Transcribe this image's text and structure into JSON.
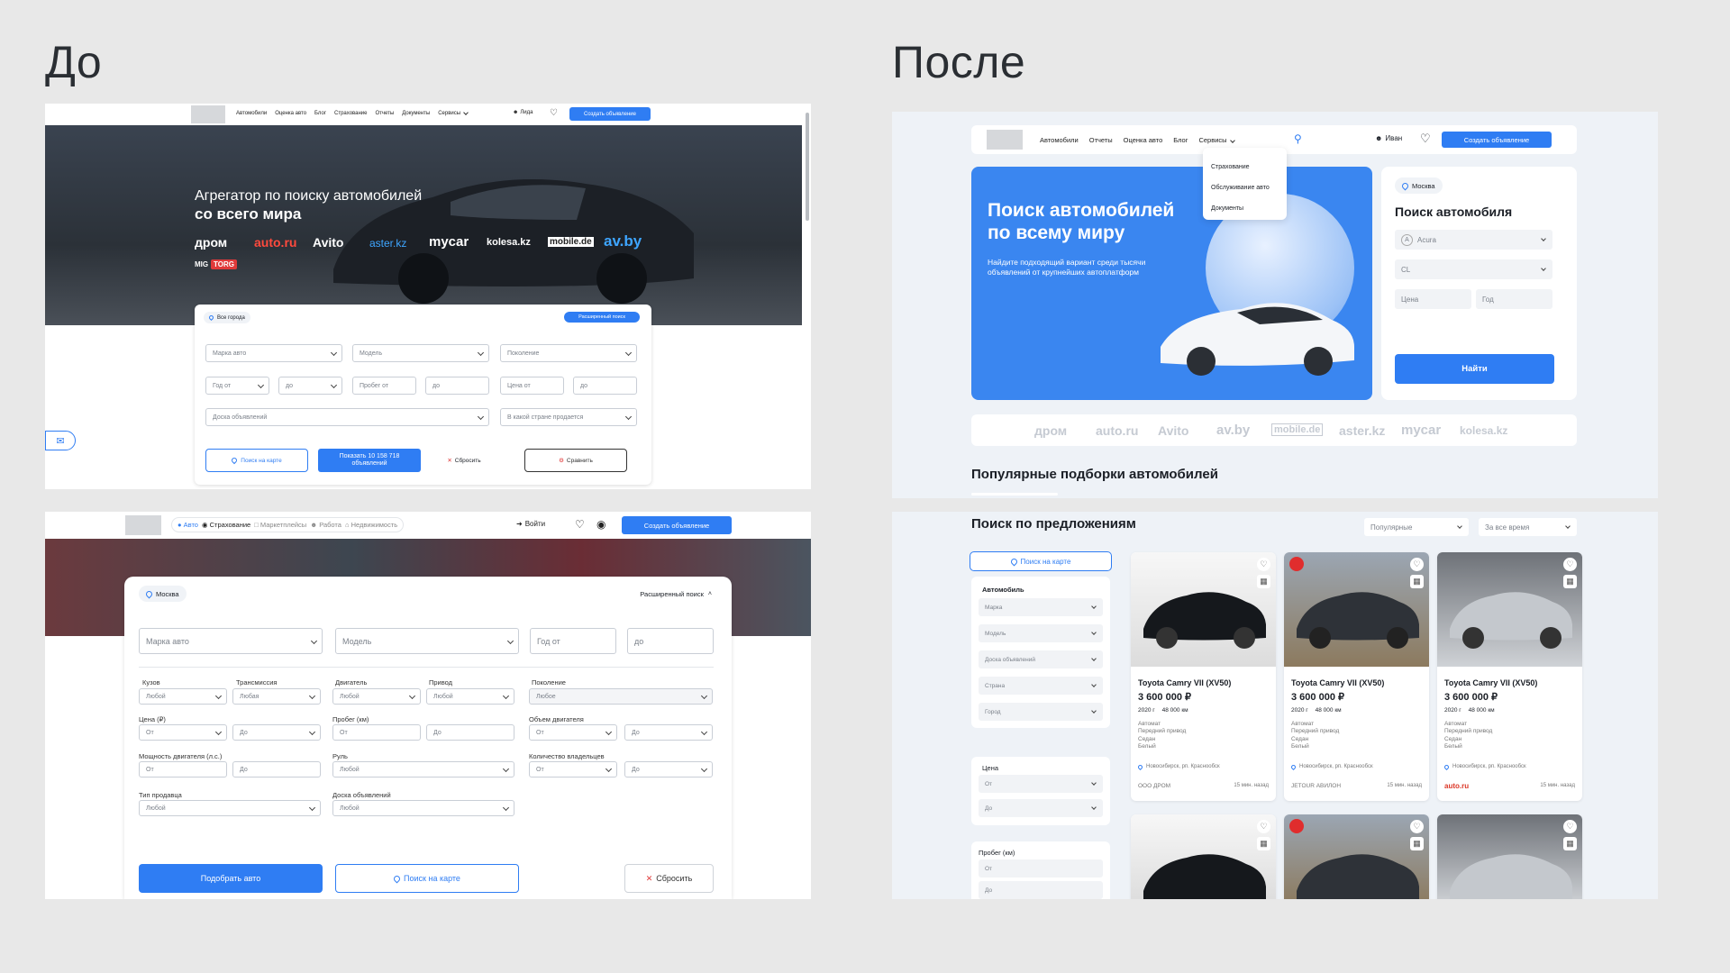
{
  "headings": {
    "before": "До",
    "after": "После"
  },
  "colors": {
    "accent": "#2f7df3",
    "background": "#e8e8e8",
    "hero_dark": "#2b3138",
    "after_bg": "#eef2f7",
    "autoru_red": "#db3727"
  },
  "before_top": {
    "nav": {
      "items": [
        "Автомобили",
        "Оценка авто",
        "Блог",
        "Страхование",
        "Отчеты",
        "Документы",
        "Сервисы"
      ],
      "user": "Лида",
      "create": "Создать объявление"
    },
    "hero": {
      "title_line1": "Агрегатор по поиску автомобилей",
      "title_line2": "со всего мира",
      "brands": [
        "дром",
        "auto.ru",
        "Avito",
        "aster.kz",
        "mycar",
        "kolesa.kz",
        "mobile.de",
        "av.by",
        "MIG",
        "TORG"
      ]
    },
    "form": {
      "city": "Все города",
      "advanced": "Расширенный поиск",
      "brand": "Марка авто",
      "model": "Модель",
      "generation": "Поколение",
      "year_from": "Год от",
      "year_to": "до",
      "mileage_from": "Пробег от",
      "mileage_to": "до",
      "price_from": "Цена от",
      "price_to": "до",
      "board": "Доска объявлений",
      "country": "В какой стране продается",
      "map": "Поиск на карте",
      "show_line1": "Показать 10 158 718",
      "show_line2": "объявлений",
      "reset": "Сбросить",
      "compare": "Сравнить"
    }
  },
  "before_bottom": {
    "nav": {
      "tabs": [
        "Авто",
        "Страхование",
        "Маркетплейсы",
        "Работа",
        "Недвижимость"
      ],
      "login": "Войти",
      "create": "Создать объявление"
    },
    "form": {
      "city": "Москва",
      "advanced": "Расширенный поиск",
      "brand": "Марка авто",
      "model": "Модель",
      "year_from": "Год от",
      "year_to": "до",
      "labels": {
        "body": "Кузов",
        "transmission": "Трансмиссия",
        "engine": "Двигатель",
        "drive": "Привод",
        "generation": "Поколение",
        "price": "Цена (₽)",
        "mileage": "Пробег (км)",
        "volume": "Объем двигателя",
        "power": "Мощность двигателя (л.с.)",
        "wheel": "Руль",
        "owners": "Количество владельцев",
        "seller": "Тип продавца",
        "board": "Доска объявлений"
      },
      "any": "Любой",
      "any_f": "Любая",
      "any_n": "Любое",
      "from": "От",
      "to": "До",
      "submit": "Подобрать авто",
      "map": "Поиск на карте",
      "reset": "Сбросить"
    }
  },
  "after_top": {
    "nav": {
      "items": [
        "Автомобили",
        "Отчеты",
        "Оценка авто",
        "Блог",
        "Сервисы"
      ],
      "dropdown": [
        "Страхование",
        "Обслуживание авто",
        "Документы"
      ],
      "user": "Иван",
      "create": "Создать объявление"
    },
    "hero": {
      "title_line1": "Поиск автомобилей",
      "title_line2": "по всему миру",
      "subtitle_line1": "Найдите подходящий вариант среди тысячи",
      "subtitle_line2": "объявлений от крупнейших автоплатформ"
    },
    "search": {
      "city": "Москва",
      "title": "Поиск автомобиля",
      "brand": "Acura",
      "model": "CL",
      "price": "Цена",
      "year": "Год",
      "find": "Найти"
    },
    "brands": [
      "дром",
      "auto.ru",
      "Avito",
      "av.by",
      "mobile.de",
      "aster.kz",
      "mycar",
      "kolesa.kz"
    ],
    "popular": "Популярные подборки автомобилей"
  },
  "after_bottom": {
    "title": "Поиск по предложениям",
    "sort": "Популярные",
    "period": "За все время",
    "sidebar": {
      "map": "Поиск на карте",
      "car": "Автомобиль",
      "car_fields": [
        "Марка",
        "Модель",
        "Доска объявлений",
        "Страна",
        "Город"
      ],
      "price": "Цена",
      "from": "От",
      "to": "До",
      "mileage": "Пробег (км)"
    },
    "cards": [
      {
        "title": "Toyota Camry VII (XV50)",
        "price": "3 600 000 ₽",
        "year": "2020 г",
        "km": "48 000 км",
        "specs": [
          "Автомат",
          "Передний привод",
          "Седан",
          "Белый"
        ],
        "location": "Новосибирск, рп. Краснообск",
        "source": "ООО ДРОМ",
        "time": "15 мин. назад"
      },
      {
        "title": "Toyota Camry VII (XV50)",
        "price": "3 600 000 ₽",
        "year": "2020 г",
        "km": "48 000 км",
        "specs": [
          "Автомат",
          "Передний привод",
          "Седан",
          "Белый"
        ],
        "location": "Новосибирск, рп. Краснообск",
        "source": "JETOUR АВИЛОН",
        "time": "15 мин. назад"
      },
      {
        "title": "Toyota Camry VII (XV50)",
        "price": "3 600 000 ₽",
        "year": "2020 г",
        "km": "48 000 км",
        "specs": [
          "Автомат",
          "Передний привод",
          "Седан",
          "Белый"
        ],
        "location": "Новосибирск, рп. Краснообск",
        "source": "auto.ru",
        "time": "15 мин. назад"
      }
    ]
  }
}
